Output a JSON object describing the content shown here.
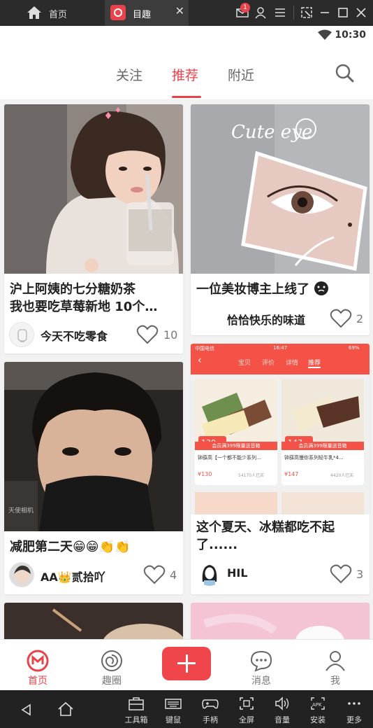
{
  "emulator": {
    "home_label": "首页",
    "tab_label": "目趣",
    "notification_count": "1",
    "toolbar": [
      "工具箱",
      "键鼠",
      "手柄",
      "全屏",
      "音量",
      "安装",
      "更多"
    ]
  },
  "status_bar": {
    "time": "10:30"
  },
  "header": {
    "tabs": [
      "关注",
      "推荐",
      "附近"
    ],
    "active_tab": "推荐"
  },
  "feed": {
    "cards": [
      {
        "title": "沪上阿姨的七分糖奶茶我也要吃草莓新地 10个…",
        "title_line1": "沪上阿姨的七分糖奶茶",
        "title_line2": "我也要吃草莓新地 10个…",
        "author": "今天不吃零食",
        "likes": "10"
      },
      {
        "title": "一位美妆博主上线了",
        "author": "恰恰快乐的味道",
        "likes": "2"
      },
      {
        "title": "减肥第二天😁😁👏👏",
        "author": "AA👑贰拾吖",
        "likes": "4"
      },
      {
        "title": "这个夏天、冰糕都吃不起了......",
        "title_line1": "这个夏天、冰糕都吃不起",
        "title_line2": "了......",
        "author": "HIL",
        "likes": "3"
      }
    ],
    "embedded_screenshot": {
      "tabs": [
        "宝贝",
        "评价",
        "详情",
        "推荐"
      ],
      "products": [
        {
          "name": "钟薛高【一个都不能少系列...",
          "price": "¥130",
          "sold": "54170人已买",
          "badge_price": "130",
          "promo": "会员满399限量送音箱"
        },
        {
          "name": "钟薛高慢你系列轻牛乳*4...",
          "price": "¥147",
          "sold": "4420人已买",
          "badge_price": "147",
          "promo": "会员满399限量送音箱"
        }
      ],
      "carrier": "中国电信",
      "time": "16:47",
      "battery": "69%"
    },
    "image_text": {
      "cute_eye": "Cute eye"
    }
  },
  "bottom_nav": {
    "items": [
      "首页",
      "趣圈",
      "消息",
      "我"
    ],
    "active": "首页"
  },
  "colors": {
    "accent": "#e8434a",
    "emulator_bg": "#2b2b2b"
  }
}
